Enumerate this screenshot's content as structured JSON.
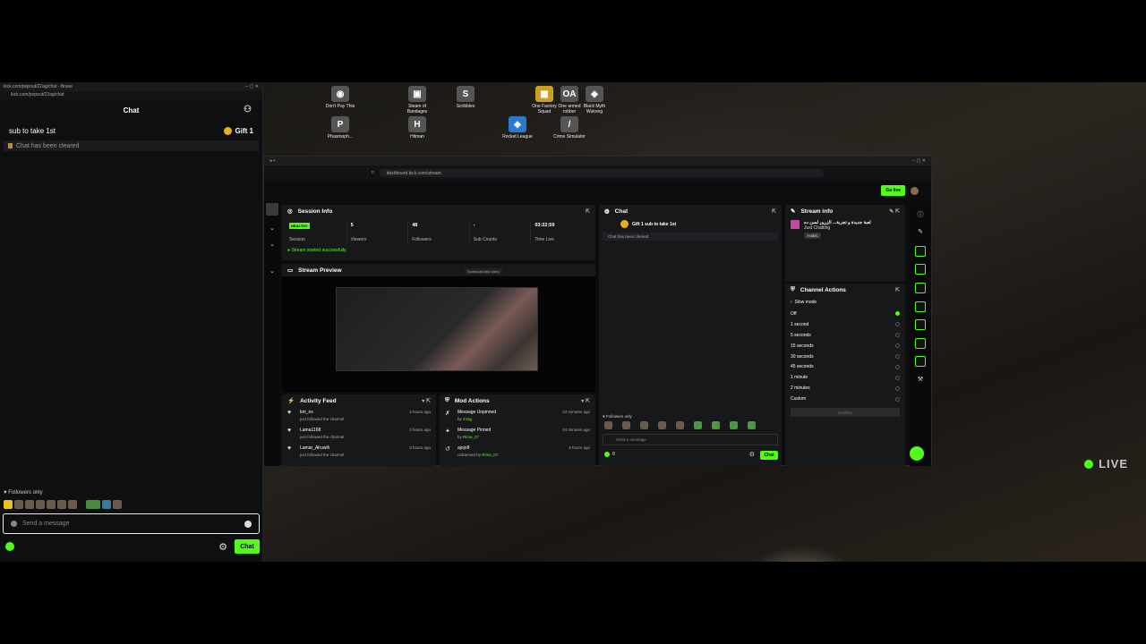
{
  "popout": {
    "window_title": "kick.com/popout/22ag/chat - Brave",
    "url": "kick.com/popout/22ag/chat",
    "header": "Chat",
    "pinned_message": "sub to take 1st",
    "pinned_gift": "Gift 1",
    "cleared_notice": "Chat has been cleared",
    "followers_only": "Followers only",
    "message_placeholder": "Send a message",
    "chat_button": "Chat"
  },
  "desktop": {
    "icons": [
      {
        "label": "Don't Pay This"
      },
      {
        "label": "Phasmoph..."
      },
      {
        "label": "Steam of Bandages"
      },
      {
        "label": "Scribbles"
      },
      {
        "label": "One Factory Squad"
      },
      {
        "label": "One armed robber"
      },
      {
        "label": "Black Myth Wukong"
      },
      {
        "label": "Rocket League"
      },
      {
        "label": "Crime Simulator"
      },
      {
        "label": "Hitman"
      }
    ],
    "live_label": "LIVE"
  },
  "browser": {
    "url": "dashboard.kick.com/stream",
    "go_live": "Go live"
  },
  "session_info": {
    "title": "Session Info",
    "health": "HEALTHY",
    "stats": [
      {
        "value": "",
        "label": "Session"
      },
      {
        "value": "5",
        "label": "Viewers"
      },
      {
        "value": "48",
        "label": "Followers"
      },
      {
        "value": "-",
        "label": "Sub Counts"
      },
      {
        "value": "03:22:59",
        "label": "Time Live"
      }
    ],
    "started_message": "Stream started successfully."
  },
  "stream_preview": {
    "title": "Stream Preview",
    "download_badge": "Download this video"
  },
  "dash_chat": {
    "title": "Chat",
    "pinned": "Gift 1 sub to take 1st",
    "cleared": "Chat has been cleared",
    "followers_only": "Followers only",
    "placeholder": "Send a message",
    "viewer_count": "0",
    "chat_button": "Chat"
  },
  "stream_info": {
    "title": "Stream info",
    "stream_title": "لعبة جديدة و تجربة... الزرين لسن ده",
    "category": "Just Chatting",
    "language": "Arabic"
  },
  "channel_actions": {
    "title": "Channel Actions",
    "mode": "Slow mode",
    "options": [
      {
        "label": "Off",
        "selected": true
      },
      {
        "label": "1 second",
        "selected": false
      },
      {
        "label": "5 seconds",
        "selected": false
      },
      {
        "label": "15 seconds",
        "selected": false
      },
      {
        "label": "30 seconds",
        "selected": false
      },
      {
        "label": "45 seconds",
        "selected": false
      },
      {
        "label": "1 minute",
        "selected": false
      },
      {
        "label": "2 minutes",
        "selected": false
      },
      {
        "label": "Custom",
        "selected": false
      }
    ],
    "confirm": "Confirm"
  },
  "activity_feed": {
    "title": "Activity Feed",
    "items": [
      {
        "user": "lori_ns",
        "action": "just followed the channel",
        "time": "2 hours ago"
      },
      {
        "user": "Lama1168",
        "action": "just followed the channel",
        "time": "3 hours ago"
      },
      {
        "user": "Lamar_Alruwili",
        "action": "just followed the channel",
        "time": "3 hours ago"
      }
    ]
  },
  "mod_actions": {
    "title": "Mod Actions",
    "items": [
      {
        "action": "Message Unpinned",
        "by": "by",
        "actor": "22ag",
        "time": "24 minutes ago"
      },
      {
        "action": "Message Pinned",
        "by": "by",
        "actor": "Rima_07",
        "time": "24 minutes ago"
      },
      {
        "action": "ajojo8",
        "by": "unbanned by",
        "actor": "Rima_07",
        "time": "9 hours ago"
      }
    ]
  },
  "colors": {
    "accent": "#53fc18",
    "panel": "#17181a",
    "bg": "#0c0d0e"
  }
}
